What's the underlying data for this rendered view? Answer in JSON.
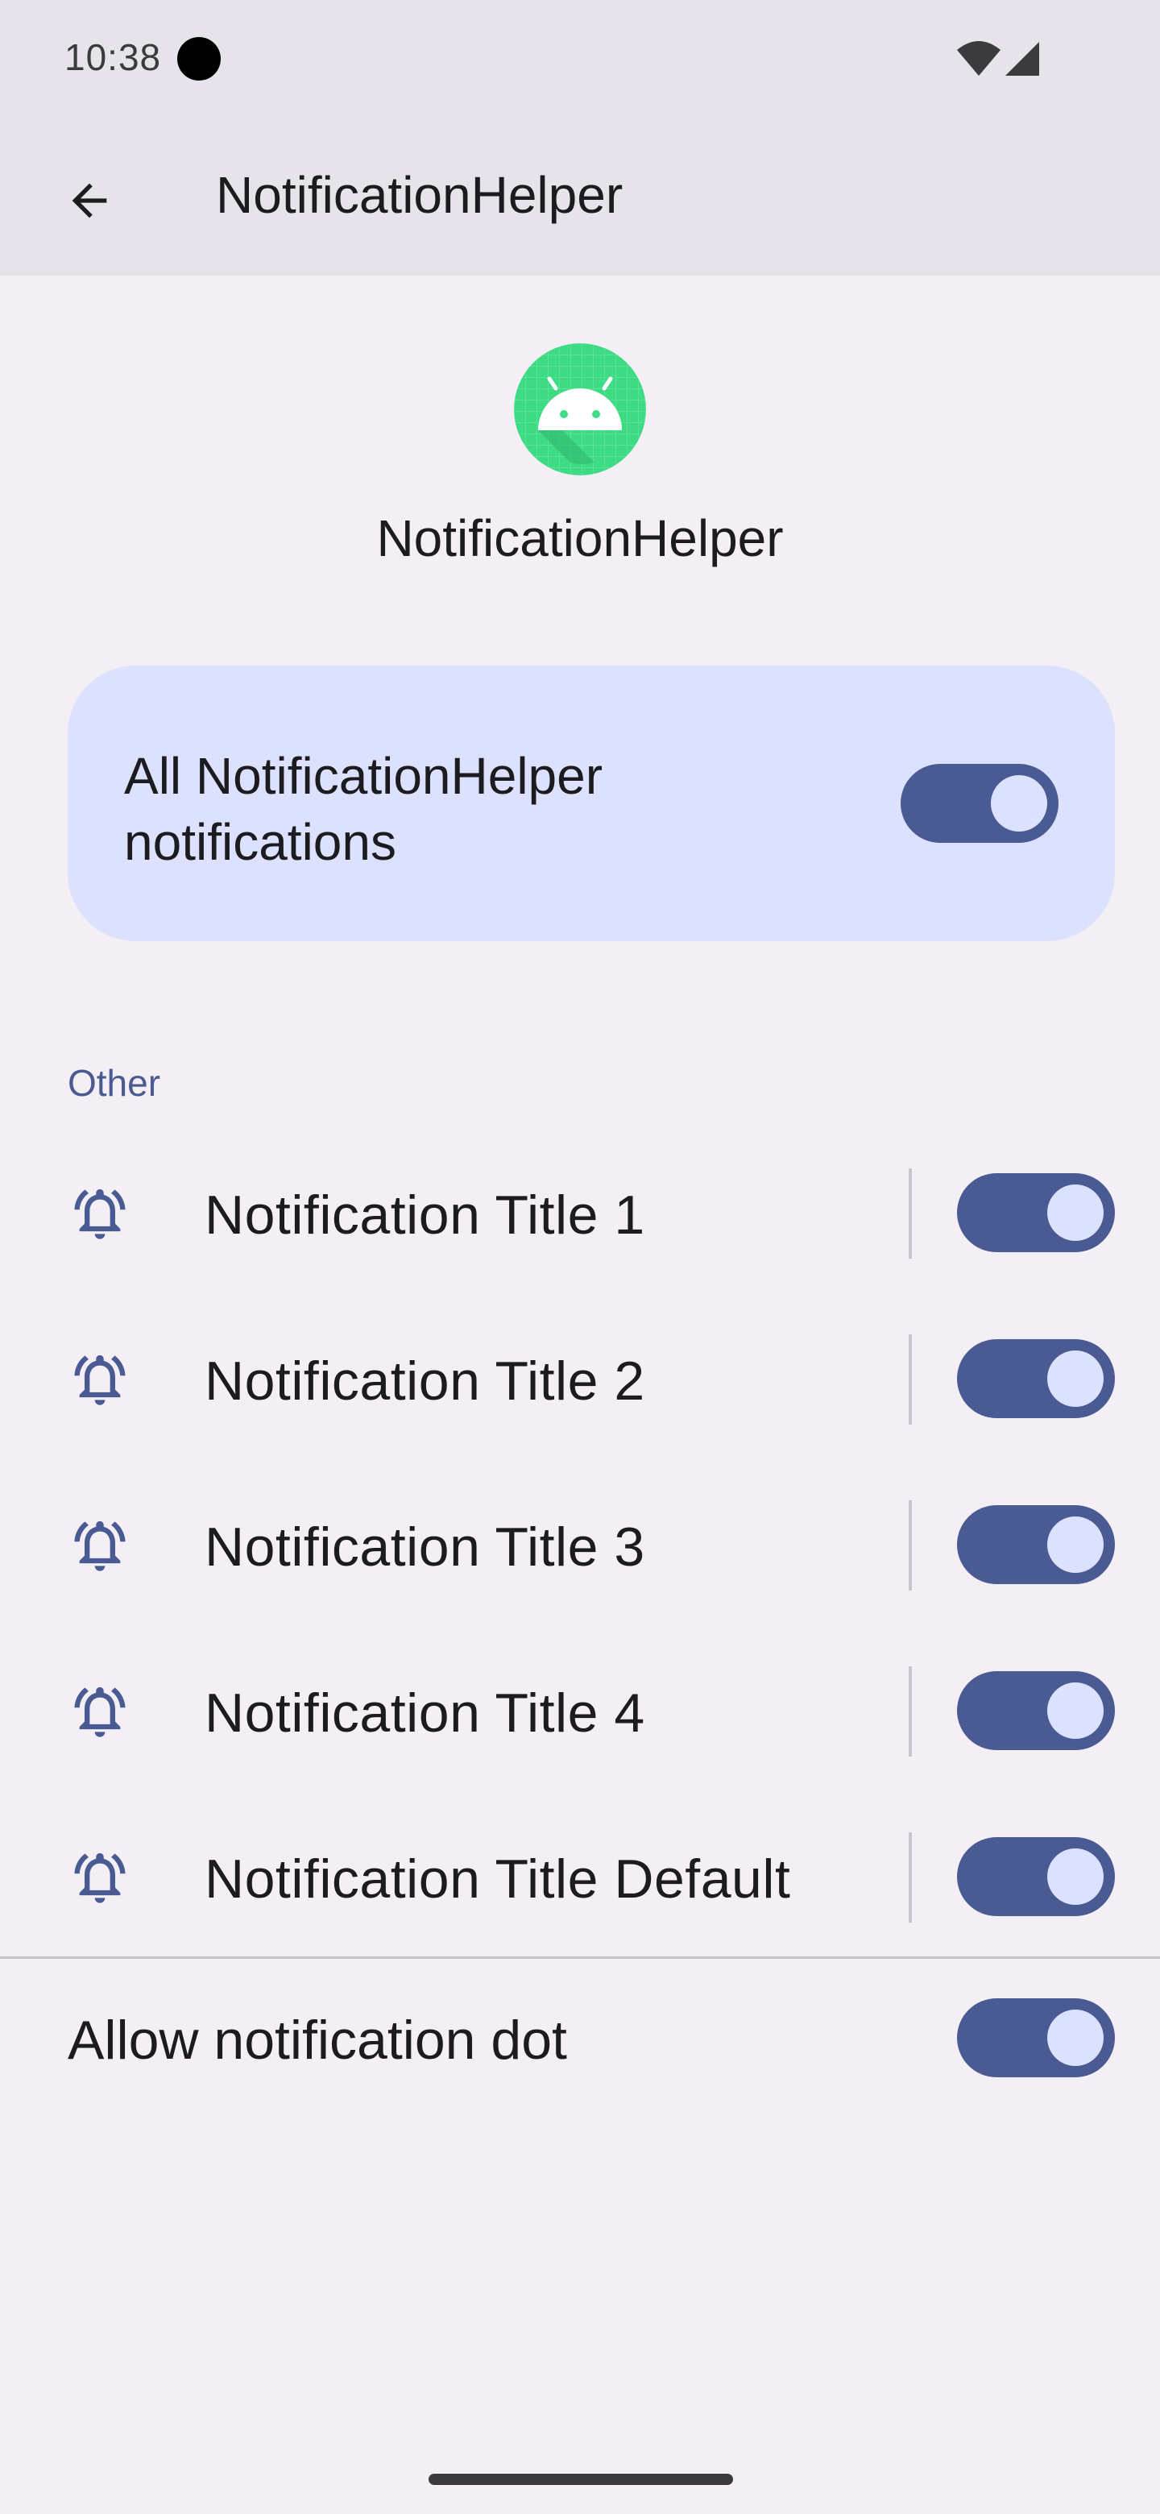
{
  "status_bar": {
    "time": "10:38"
  },
  "app_bar": {
    "title": "NotificationHelper"
  },
  "app_header": {
    "name": "NotificationHelper"
  },
  "master_toggle": {
    "label": "All NotificationHelper notifications",
    "enabled": true
  },
  "section": {
    "header": "Other"
  },
  "channels": [
    {
      "title": "Notification Title 1",
      "enabled": true
    },
    {
      "title": "Notification Title 2",
      "enabled": true
    },
    {
      "title": "Notification Title 3",
      "enabled": true
    },
    {
      "title": "Notification Title 4",
      "enabled": true
    },
    {
      "title": "Notification Title Default",
      "enabled": true
    }
  ],
  "notification_dot": {
    "label": "Allow notification dot",
    "enabled": true
  },
  "colors": {
    "background": "#f3eff5",
    "app_bar": "#e6e3ea",
    "card": "#dce1fd",
    "accent": "#4a5a92",
    "app_icon": "#3ddc84"
  },
  "icons": {
    "back": "arrow-back-icon",
    "app": "android-icon",
    "channel": "bell-ringing-icon",
    "wifi": "wifi-icon",
    "signal": "cellular-signal-icon"
  }
}
